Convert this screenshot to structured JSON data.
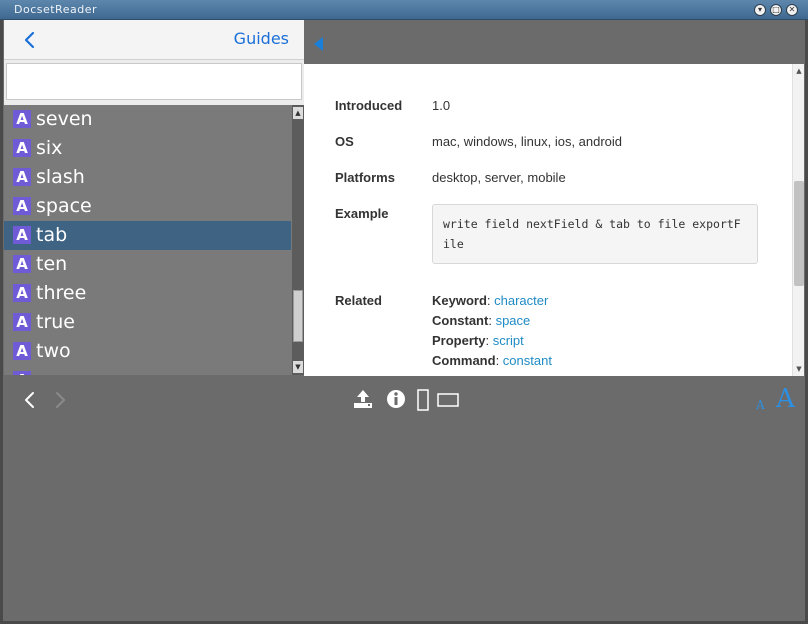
{
  "window": {
    "title": "DocsetReader"
  },
  "nav": {
    "back_icon": "chevron-left-icon",
    "guides_label": "Guides"
  },
  "search": {
    "value": "",
    "placeholder": ""
  },
  "list": {
    "items": [
      {
        "badge": "A",
        "label": "seven",
        "selected": false
      },
      {
        "badge": "A",
        "label": "six",
        "selected": false
      },
      {
        "badge": "A",
        "label": "slash",
        "selected": false
      },
      {
        "badge": "A",
        "label": "space",
        "selected": false
      },
      {
        "badge": "A",
        "label": "tab",
        "selected": true
      },
      {
        "badge": "A",
        "label": "ten",
        "selected": false
      },
      {
        "badge": "A",
        "label": "three",
        "selected": false
      },
      {
        "badge": "A",
        "label": "true",
        "selected": false
      },
      {
        "badge": "A",
        "label": "two",
        "selected": false
      },
      {
        "badge": "A",
        "label": "",
        "selected": false
      }
    ]
  },
  "content": {
    "introduced": {
      "key": "Introduced",
      "value": "1.0"
    },
    "os": {
      "key": "OS",
      "value": "mac, windows, linux, ios, android"
    },
    "platforms": {
      "key": "Platforms",
      "value": "desktop, server, mobile"
    },
    "example": {
      "key": "Example",
      "code": "write field nextField & tab to file exportFile"
    },
    "related": {
      "key": "Related",
      "items": [
        {
          "type": "Keyword",
          "link": "character"
        },
        {
          "type": "Constant",
          "link": "space"
        },
        {
          "type": "Property",
          "link": "script"
        },
        {
          "type": "Command",
          "link": "constant"
        }
      ]
    }
  },
  "toolbar": {
    "icons": [
      "chevron-left-icon",
      "chevron-right-icon",
      "share-icon",
      "info-icon",
      "portrait-icon",
      "landscape-icon"
    ],
    "font_small": "A",
    "font_large": "A"
  },
  "colors": {
    "accent": "#1a6fd8",
    "badge": "#6f5bd6",
    "selection": "#3e6383",
    "link": "#1f8bc6",
    "titlebar": "#4f789f"
  }
}
